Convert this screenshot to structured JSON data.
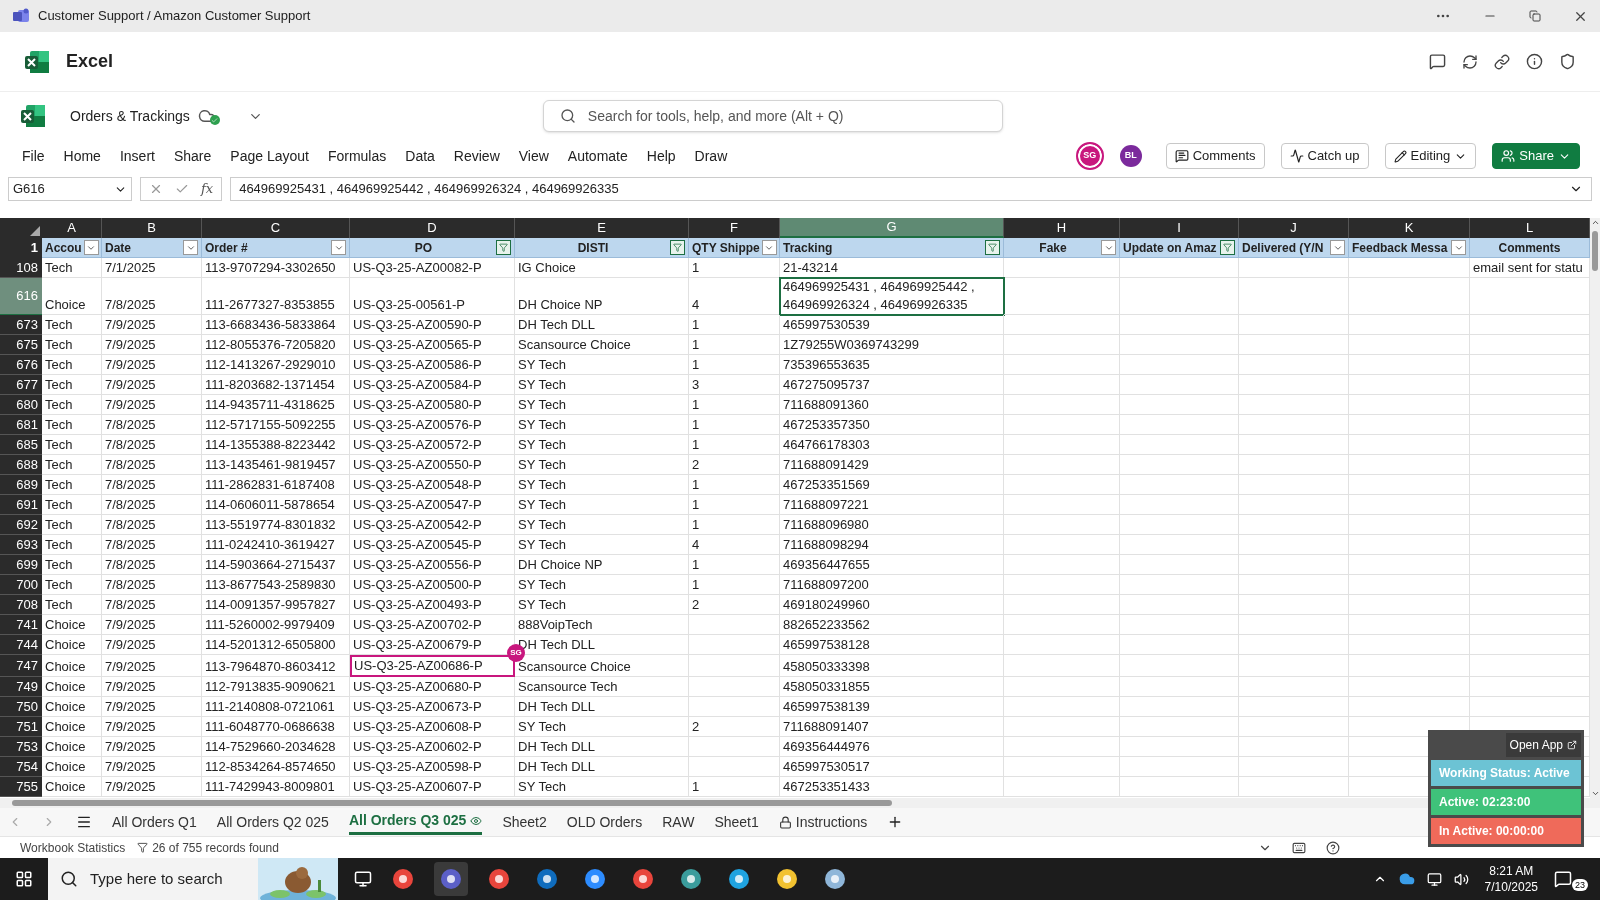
{
  "window": {
    "title": "Customer Support / Amazon Customer Support"
  },
  "app": {
    "name": "Excel"
  },
  "document": {
    "name": "Orders & Trackings",
    "search_placeholder": "Search for tools, help, and more (Alt + Q)"
  },
  "menu": [
    "File",
    "Home",
    "Insert",
    "Share",
    "Page Layout",
    "Formulas",
    "Data",
    "Review",
    "View",
    "Automate",
    "Help",
    "Draw"
  ],
  "collaborators": [
    {
      "initials": "SG",
      "color": "#c8177e",
      "ring": true
    },
    {
      "initials": "BL",
      "color": "#7b2a9c",
      "ring": false
    }
  ],
  "actions": [
    {
      "kind": "comments",
      "label": "Comments"
    },
    {
      "kind": "catchup",
      "label": "Catch up"
    },
    {
      "kind": "editing",
      "label": "Editing"
    },
    {
      "kind": "share",
      "label": "Share"
    }
  ],
  "formula_bar": {
    "name_box": "G616",
    "function_label": "fx",
    "value": "464969925431 , 464969925442 , 464969926324 , 464969926335"
  },
  "columns": [
    {
      "letter": "A",
      "header": "Accou",
      "kind": "filterable",
      "filtered": false,
      "selected": false
    },
    {
      "letter": "B",
      "header": "Date",
      "kind": "filterable",
      "filtered": false,
      "selected": false
    },
    {
      "letter": "C",
      "header": "Order #",
      "kind": "filterable",
      "filtered": false,
      "selected": false
    },
    {
      "letter": "D",
      "header": "PO",
      "kind": "filterable",
      "filtered": true,
      "selected": false
    },
    {
      "letter": "E",
      "header": "DISTI",
      "kind": "filterable",
      "filtered": true,
      "selected": false
    },
    {
      "letter": "F",
      "header": "QTY Shippe",
      "kind": "filterable",
      "filtered": false,
      "selected": false
    },
    {
      "letter": "G",
      "header": "Tracking",
      "kind": "filterable",
      "filtered": true,
      "selected": true
    },
    {
      "letter": "H",
      "header": "Fake",
      "kind": "filterable",
      "filtered": false,
      "selected": false
    },
    {
      "letter": "I",
      "header": "Update on Amaz",
      "kind": "filterable",
      "filtered": true,
      "selected": false
    },
    {
      "letter": "J",
      "header": "Delivered (Y/N",
      "kind": "filterable",
      "filtered": false,
      "selected": false
    },
    {
      "letter": "K",
      "header": "Feedback Messa",
      "kind": "filterable",
      "filtered": false,
      "selected": false
    },
    {
      "letter": "L",
      "header": "Comments",
      "kind": "plain",
      "selected": false
    }
  ],
  "header_row": "1",
  "rows": [
    {
      "number": "108",
      "selected": false,
      "cells": {
        "A": "Tech",
        "B": "7/1/2025",
        "C": "113-9707294-3302650",
        "D": "US-Q3-25-AZ00082-P",
        "E": "IG Choice",
        "F": "1",
        "G": "21-43214",
        "L": "email sent for statu"
      }
    },
    {
      "number": "616",
      "selected": true,
      "cells": {
        "A": "Choice",
        "B": "7/8/2025",
        "C": "111-2677327-8353855",
        "D": "US-Q3-25-00561-P",
        "E": "DH Choice NP",
        "F": "4",
        "G": "464969925431 , 464969925442 , 464969926324 , 464969926335"
      }
    },
    {
      "number": "673",
      "selected": false,
      "cells": {
        "A": "Tech",
        "B": "7/9/2025",
        "C": "113-6683436-5833864",
        "D": "US-Q3-25-AZ00590-P",
        "E": "DH Tech DLL",
        "F": "1",
        "G": "465997530539"
      }
    },
    {
      "number": "675",
      "selected": false,
      "cells": {
        "A": "Tech",
        "B": "7/9/2025",
        "C": "112-8055376-7205820",
        "D": "US-Q3-25-AZ00565-P",
        "E": "Scansource Choice",
        "F": "1",
        "G": "1Z79255W0369743299"
      }
    },
    {
      "number": "676",
      "selected": false,
      "cells": {
        "A": "Tech",
        "B": "7/9/2025",
        "C": "112-1413267-2929010",
        "D": "US-Q3-25-AZ00586-P",
        "E": "SY Tech",
        "F": "1",
        "G": "735396553635"
      }
    },
    {
      "number": "677",
      "selected": false,
      "cells": {
        "A": "Tech",
        "B": "7/9/2025",
        "C": "111-8203682-1371454",
        "D": "US-Q3-25-AZ00584-P",
        "E": "SY Tech",
        "F": "3",
        "G": "467275095737"
      }
    },
    {
      "number": "680",
      "selected": false,
      "cells": {
        "A": "Tech",
        "B": "7/9/2025",
        "C": "114-9435711-4318625",
        "D": "US-Q3-25-AZ00580-P",
        "E": "SY Tech",
        "F": "1",
        "G": "711688091360"
      }
    },
    {
      "number": "681",
      "selected": false,
      "cells": {
        "A": "Tech",
        "B": "7/8/2025",
        "C": "112-5717155-5092255",
        "D": "US-Q3-25-AZ00576-P",
        "E": "SY Tech",
        "F": "1",
        "G": "467253357350"
      }
    },
    {
      "number": "685",
      "selected": false,
      "cells": {
        "A": "Tech",
        "B": "7/8/2025",
        "C": "114-1355388-8223442",
        "D": "US-Q3-25-AZ00572-P",
        "E": "SY Tech",
        "F": "1",
        "G": "464766178303"
      }
    },
    {
      "number": "688",
      "selected": false,
      "cells": {
        "A": "Tech",
        "B": "7/8/2025",
        "C": "113-1435461-9819457",
        "D": "US-Q3-25-AZ00550-P",
        "E": "SY Tech",
        "F": "2",
        "G": "711688091429"
      }
    },
    {
      "number": "689",
      "selected": false,
      "cells": {
        "A": "Tech",
        "B": "7/8/2025",
        "C": "111-2862831-6187408",
        "D": "US-Q3-25-AZ00548-P",
        "E": "SY Tech",
        "F": "1",
        "G": "467253351569"
      }
    },
    {
      "number": "691",
      "selected": false,
      "cells": {
        "A": "Tech",
        "B": "7/8/2025",
        "C": "114-0606011-5878654",
        "D": "US-Q3-25-AZ00547-P",
        "E": "SY Tech",
        "F": "1",
        "G": "711688097221"
      }
    },
    {
      "number": "692",
      "selected": false,
      "cells": {
        "A": "Tech",
        "B": "7/8/2025",
        "C": "113-5519774-8301832",
        "D": "US-Q3-25-AZ00542-P",
        "E": "SY Tech",
        "F": "1",
        "G": "711688096980"
      }
    },
    {
      "number": "693",
      "selected": false,
      "cells": {
        "A": "Tech",
        "B": "7/8/2025",
        "C": "111-0242410-3619427",
        "D": "US-Q3-25-AZ00545-P",
        "E": "SY Tech",
        "F": "4",
        "G": "711688098294"
      }
    },
    {
      "number": "699",
      "selected": false,
      "cells": {
        "A": "Tech",
        "B": "7/8/2025",
        "C": "114-5903664-2715437",
        "D": "US-Q3-25-AZ00556-P",
        "E": "DH Choice NP",
        "F": "1",
        "G": "469356447655"
      }
    },
    {
      "number": "700",
      "selected": false,
      "cells": {
        "A": "Tech",
        "B": "7/8/2025",
        "C": "113-8677543-2589830",
        "D": "US-Q3-25-AZ00500-P",
        "E": "SY Tech",
        "F": "1",
        "G": "711688097200"
      }
    },
    {
      "number": "708",
      "selected": false,
      "cells": {
        "A": "Tech",
        "B": "7/8/2025",
        "C": "114-0091357-9957827",
        "D": "US-Q3-25-AZ00493-P",
        "E": "SY Tech",
        "F": "2",
        "G": "469180249960"
      }
    },
    {
      "number": "741",
      "selected": false,
      "cells": {
        "A": "Choice",
        "B": "7/9/2025",
        "C": "111-5260002-9979409",
        "D": "US-Q3-25-AZ00702-P",
        "E": "888VoipTech",
        "G": "882652233562"
      }
    },
    {
      "number": "744",
      "selected": false,
      "cells": {
        "A": "Choice",
        "B": "7/9/2025",
        "C": "114-5201312-6505800",
        "D": "US-Q3-25-AZ00679-P",
        "E": "DH Tech DLL",
        "G": "465997538128"
      }
    },
    {
      "number": "747",
      "selected": false,
      "cells": {
        "A": "Choice",
        "B": "7/9/2025",
        "C": "113-7964870-8603412",
        "D": {
          "text": "US-Q3-25-AZ00686-P",
          "presence": {
            "initials": "SG",
            "color": "#c8177e"
          }
        },
        "E": "Scansource Choice",
        "G": "458050333398"
      }
    },
    {
      "number": "749",
      "selected": false,
      "cells": {
        "A": "Choice",
        "B": "7/9/2025",
        "C": "112-7913835-9090621",
        "D": "US-Q3-25-AZ00680-P",
        "E": "Scansource Tech",
        "G": "458050331855"
      }
    },
    {
      "number": "750",
      "selected": false,
      "cells": {
        "A": "Choice",
        "B": "7/9/2025",
        "C": "111-2140808-0721061",
        "D": "US-Q3-25-AZ00673-P",
        "E": "DH Tech DLL",
        "G": "465997538139"
      }
    },
    {
      "number": "751",
      "selected": false,
      "cells": {
        "A": "Choice",
        "B": "7/9/2025",
        "C": "111-6048770-0686638",
        "D": "US-Q3-25-AZ00608-P",
        "E": "SY Tech",
        "F": "2",
        "G": "711688091407"
      }
    },
    {
      "number": "753",
      "selected": false,
      "cells": {
        "A": "Choice",
        "B": "7/9/2025",
        "C": "114-7529660-2034628",
        "D": "US-Q3-25-AZ00602-P",
        "E": "DH Tech DLL",
        "G": "469356444976"
      }
    },
    {
      "number": "754",
      "selected": false,
      "cells": {
        "A": "Choice",
        "B": "7/9/2025",
        "C": "112-8534264-8574650",
        "D": "US-Q3-25-AZ00598-P",
        "E": "DH Tech DLL",
        "G": "465997530517"
      }
    },
    {
      "number": "755",
      "selected": false,
      "cells": {
        "A": "Choice",
        "B": "7/9/2025",
        "C": "111-7429943-8009801",
        "D": "US-Q3-25-AZ00607-P",
        "E": "SY Tech",
        "F": "1",
        "G": "467253351433"
      }
    }
  ],
  "sheet_tabs": [
    {
      "label": "All Orders Q1",
      "selected": false,
      "kind": "plain"
    },
    {
      "label": "All Orders Q2 025",
      "selected": false,
      "kind": "plain"
    },
    {
      "label": "All Orders Q3 025",
      "selected": true,
      "kind": "viewed"
    },
    {
      "label": "Sheet2",
      "selected": false,
      "kind": "plain"
    },
    {
      "label": "OLD Orders",
      "selected": false,
      "kind": "plain"
    },
    {
      "label": "RAW",
      "selected": false,
      "kind": "plain"
    },
    {
      "label": "Sheet1",
      "selected": false,
      "kind": "plain"
    },
    {
      "label": "Instructions",
      "selected": false,
      "kind": "locked"
    }
  ],
  "status_bar": {
    "workbook_statistics": "Workbook Statistics",
    "records": "26 of 755 records found"
  },
  "tracker": {
    "open_app": "Open App",
    "status": "Working Status: Active",
    "active": "Active: 02:23:00",
    "inactive": "In Active: 00:00:00"
  },
  "taskbar": {
    "search_placeholder": "Type here to search",
    "time": "8:21 AM",
    "date": "7/10/2025",
    "notifications": "23"
  }
}
